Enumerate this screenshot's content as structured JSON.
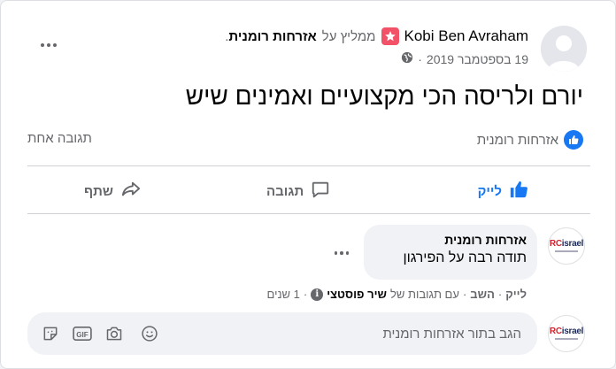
{
  "post": {
    "author": "Kobi Ben Avraham",
    "recommends_text": "ממליץ על",
    "page_name": "אזרחות רומנית",
    "page_period": ".",
    "date": "19 בספטמבר 2019",
    "date_sep": "·",
    "text": "יורם ולריסה הכי מקצועיים ואמינים שיש"
  },
  "reactions": {
    "likers": "אזרחות רומנית",
    "comment_count": "תגובה אחת"
  },
  "actions": {
    "like": "לייק",
    "comment": "תגובה",
    "share": "שתף"
  },
  "comment": {
    "avatar_logo": "RCisrael",
    "author": "אזרחות רומנית",
    "text": "תודה רבה על הפירגון",
    "like": "לייק",
    "reply": "השב",
    "sep": "·",
    "responded_prefix": "עם תגובות של",
    "responded_name": "שיר פוסטצי",
    "time": "1 שנים"
  },
  "composer": {
    "placeholder": "הגב בתור אזרחות רומנית"
  },
  "colors": {
    "accent": "#1877f2",
    "badge": "#f25268",
    "muted": "#65676b"
  }
}
